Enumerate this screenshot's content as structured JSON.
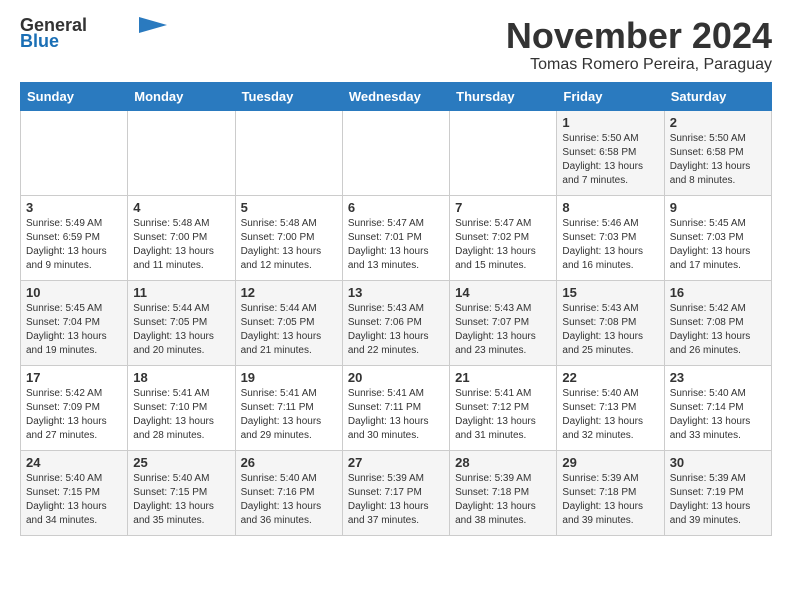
{
  "logo": {
    "general": "General",
    "blue": "Blue"
  },
  "header": {
    "month": "November 2024",
    "location": "Tomas Romero Pereira, Paraguay"
  },
  "weekdays": [
    "Sunday",
    "Monday",
    "Tuesday",
    "Wednesday",
    "Thursday",
    "Friday",
    "Saturday"
  ],
  "weeks": [
    [
      {
        "day": "",
        "info": ""
      },
      {
        "day": "",
        "info": ""
      },
      {
        "day": "",
        "info": ""
      },
      {
        "day": "",
        "info": ""
      },
      {
        "day": "",
        "info": ""
      },
      {
        "day": "1",
        "info": "Sunrise: 5:50 AM\nSunset: 6:58 PM\nDaylight: 13 hours and 7 minutes."
      },
      {
        "day": "2",
        "info": "Sunrise: 5:50 AM\nSunset: 6:58 PM\nDaylight: 13 hours and 8 minutes."
      }
    ],
    [
      {
        "day": "3",
        "info": "Sunrise: 5:49 AM\nSunset: 6:59 PM\nDaylight: 13 hours and 9 minutes."
      },
      {
        "day": "4",
        "info": "Sunrise: 5:48 AM\nSunset: 7:00 PM\nDaylight: 13 hours and 11 minutes."
      },
      {
        "day": "5",
        "info": "Sunrise: 5:48 AM\nSunset: 7:00 PM\nDaylight: 13 hours and 12 minutes."
      },
      {
        "day": "6",
        "info": "Sunrise: 5:47 AM\nSunset: 7:01 PM\nDaylight: 13 hours and 13 minutes."
      },
      {
        "day": "7",
        "info": "Sunrise: 5:47 AM\nSunset: 7:02 PM\nDaylight: 13 hours and 15 minutes."
      },
      {
        "day": "8",
        "info": "Sunrise: 5:46 AM\nSunset: 7:03 PM\nDaylight: 13 hours and 16 minutes."
      },
      {
        "day": "9",
        "info": "Sunrise: 5:45 AM\nSunset: 7:03 PM\nDaylight: 13 hours and 17 minutes."
      }
    ],
    [
      {
        "day": "10",
        "info": "Sunrise: 5:45 AM\nSunset: 7:04 PM\nDaylight: 13 hours and 19 minutes."
      },
      {
        "day": "11",
        "info": "Sunrise: 5:44 AM\nSunset: 7:05 PM\nDaylight: 13 hours and 20 minutes."
      },
      {
        "day": "12",
        "info": "Sunrise: 5:44 AM\nSunset: 7:05 PM\nDaylight: 13 hours and 21 minutes."
      },
      {
        "day": "13",
        "info": "Sunrise: 5:43 AM\nSunset: 7:06 PM\nDaylight: 13 hours and 22 minutes."
      },
      {
        "day": "14",
        "info": "Sunrise: 5:43 AM\nSunset: 7:07 PM\nDaylight: 13 hours and 23 minutes."
      },
      {
        "day": "15",
        "info": "Sunrise: 5:43 AM\nSunset: 7:08 PM\nDaylight: 13 hours and 25 minutes."
      },
      {
        "day": "16",
        "info": "Sunrise: 5:42 AM\nSunset: 7:08 PM\nDaylight: 13 hours and 26 minutes."
      }
    ],
    [
      {
        "day": "17",
        "info": "Sunrise: 5:42 AM\nSunset: 7:09 PM\nDaylight: 13 hours and 27 minutes."
      },
      {
        "day": "18",
        "info": "Sunrise: 5:41 AM\nSunset: 7:10 PM\nDaylight: 13 hours and 28 minutes."
      },
      {
        "day": "19",
        "info": "Sunrise: 5:41 AM\nSunset: 7:11 PM\nDaylight: 13 hours and 29 minutes."
      },
      {
        "day": "20",
        "info": "Sunrise: 5:41 AM\nSunset: 7:11 PM\nDaylight: 13 hours and 30 minutes."
      },
      {
        "day": "21",
        "info": "Sunrise: 5:41 AM\nSunset: 7:12 PM\nDaylight: 13 hours and 31 minutes."
      },
      {
        "day": "22",
        "info": "Sunrise: 5:40 AM\nSunset: 7:13 PM\nDaylight: 13 hours and 32 minutes."
      },
      {
        "day": "23",
        "info": "Sunrise: 5:40 AM\nSunset: 7:14 PM\nDaylight: 13 hours and 33 minutes."
      }
    ],
    [
      {
        "day": "24",
        "info": "Sunrise: 5:40 AM\nSunset: 7:15 PM\nDaylight: 13 hours and 34 minutes."
      },
      {
        "day": "25",
        "info": "Sunrise: 5:40 AM\nSunset: 7:15 PM\nDaylight: 13 hours and 35 minutes."
      },
      {
        "day": "26",
        "info": "Sunrise: 5:40 AM\nSunset: 7:16 PM\nDaylight: 13 hours and 36 minutes."
      },
      {
        "day": "27",
        "info": "Sunrise: 5:39 AM\nSunset: 7:17 PM\nDaylight: 13 hours and 37 minutes."
      },
      {
        "day": "28",
        "info": "Sunrise: 5:39 AM\nSunset: 7:18 PM\nDaylight: 13 hours and 38 minutes."
      },
      {
        "day": "29",
        "info": "Sunrise: 5:39 AM\nSunset: 7:18 PM\nDaylight: 13 hours and 39 minutes."
      },
      {
        "day": "30",
        "info": "Sunrise: 5:39 AM\nSunset: 7:19 PM\nDaylight: 13 hours and 39 minutes."
      }
    ]
  ]
}
